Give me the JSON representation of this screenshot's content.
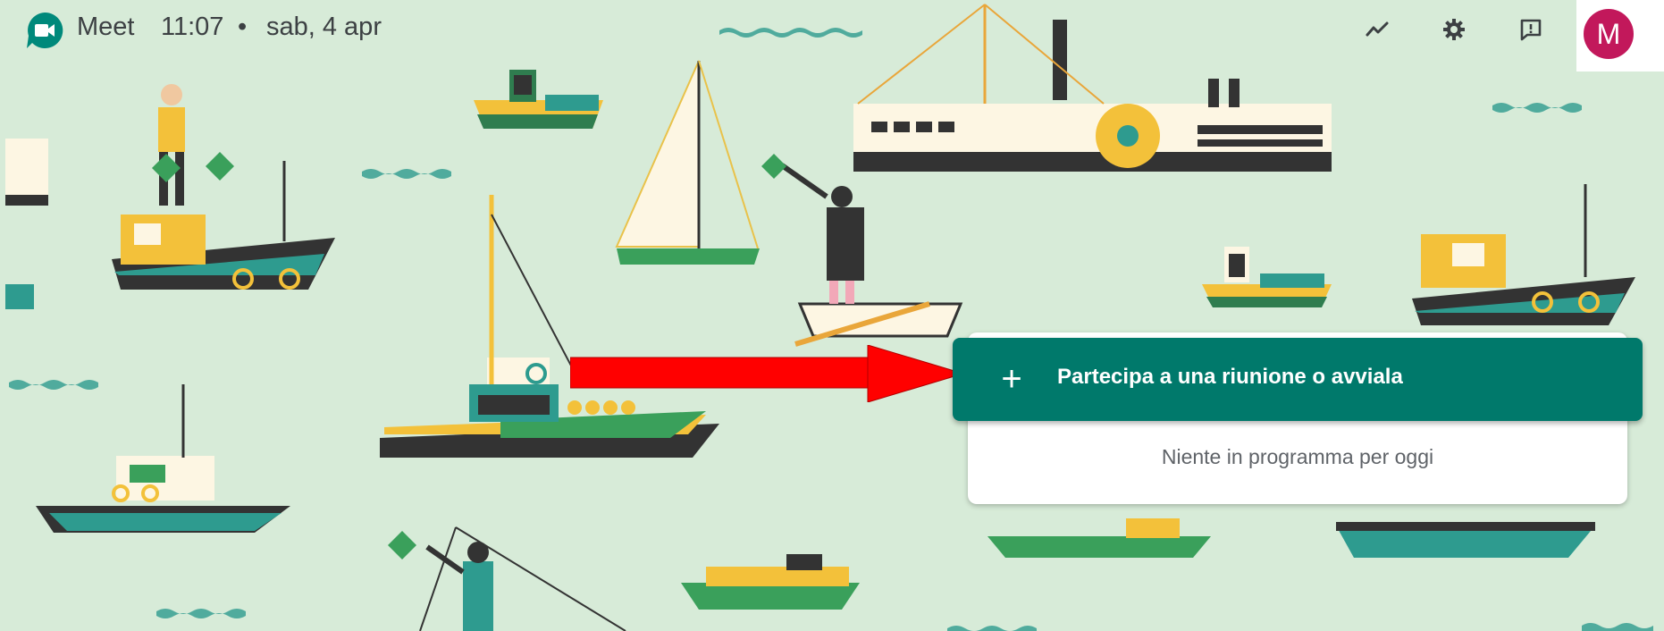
{
  "header": {
    "app_name": "Meet",
    "time": "11:07",
    "separator": "•",
    "date": "sab, 4 apr",
    "avatar_letter": "M"
  },
  "icons": {
    "logo": "google-meet-camera-icon",
    "quality": "trending-line-icon",
    "settings": "gear-icon",
    "feedback": "feedback-exclamation-icon"
  },
  "card": {
    "join_plus": "+",
    "join_label": "Partecipa a una riunione o avviala",
    "empty_message": "Niente in programma per oggi"
  },
  "colors": {
    "background": "#d7ebd8",
    "accent": "#00796b",
    "avatar": "#c2185b",
    "annotation_arrow": "#ff0000"
  }
}
